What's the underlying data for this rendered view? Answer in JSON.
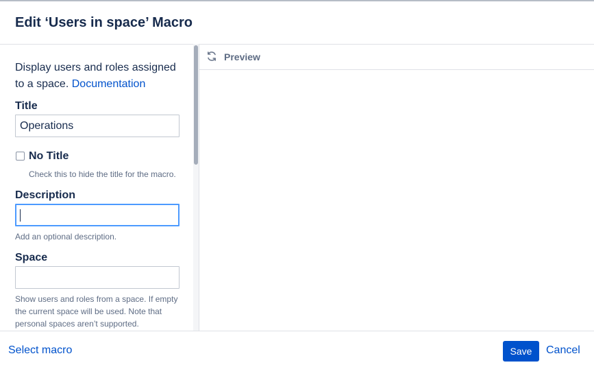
{
  "dialog": {
    "title": "Edit ‘Users in space’ Macro"
  },
  "form": {
    "intro_text": "Display users and roles assigned to a space.",
    "documentation_link": "Documentation",
    "title_label": "Title",
    "title_value": "Operations",
    "no_title_label": "No Title",
    "no_title_checked": false,
    "no_title_help": "Check this to hide the title for the macro.",
    "description_label": "Description",
    "description_value": "",
    "description_help": "Add an optional description.",
    "space_label": "Space",
    "space_value": "",
    "space_help": "Show users and roles from a space. If empty the current space will be used. Note that personal spaces aren’t supported."
  },
  "preview": {
    "icon": "refresh-icon",
    "label": "Preview"
  },
  "footer": {
    "select_macro": "Select macro",
    "save": "Save",
    "cancel": "Cancel"
  },
  "colors": {
    "primary": "#0052cc",
    "focus": "#4c9aff",
    "text": "#172b4d",
    "subtle": "#5e6c84"
  }
}
